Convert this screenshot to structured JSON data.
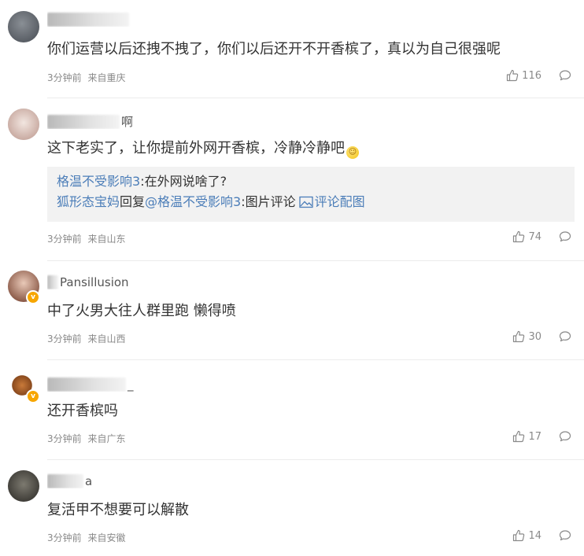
{
  "comments": [
    {
      "name_tail": "",
      "content": "你们运营以后还拽不拽了，你们以后还开不开香槟了，真以为自己很强呢",
      "time": "3分钟前",
      "location": "来自重庆",
      "likes": "116"
    },
    {
      "name_tail": "啊",
      "content": "这下老实了，让你提前外网开香槟，冷静冷静吧",
      "reply": {
        "line1_user": "格温不受影响3",
        "line1_text": ":在外网说啥了?",
        "line2_user": "狐形态宝妈",
        "line2_mid": "回复",
        "line2_target": "@格温不受影响3",
        "line2_text": ":图片评论",
        "line2_link": "评论配图"
      },
      "time": "3分钟前",
      "location": "来自山东",
      "likes": "74"
    },
    {
      "name_tail": "Pansillusion",
      "content": "中了火男大往人群里跑 懒得喷",
      "time": "3分钟前",
      "location": "来自山西",
      "likes": "30"
    },
    {
      "name_tail": "_",
      "content": "还开香槟吗",
      "time": "3分钟前",
      "location": "来自广东",
      "likes": "17"
    },
    {
      "name_tail": "a",
      "content": "复活甲不想要可以解散",
      "time": "3分钟前",
      "location": "来自安徽",
      "likes": "14"
    }
  ],
  "colors": {
    "link": "#4b7db8",
    "meta": "#8a8a8a",
    "verified_badge": "#f7a600"
  },
  "icons": {
    "like": "thumbs-up-icon",
    "comment": "comment-bubble-icon",
    "image": "image-icon",
    "verified": "verified-badge-icon"
  }
}
